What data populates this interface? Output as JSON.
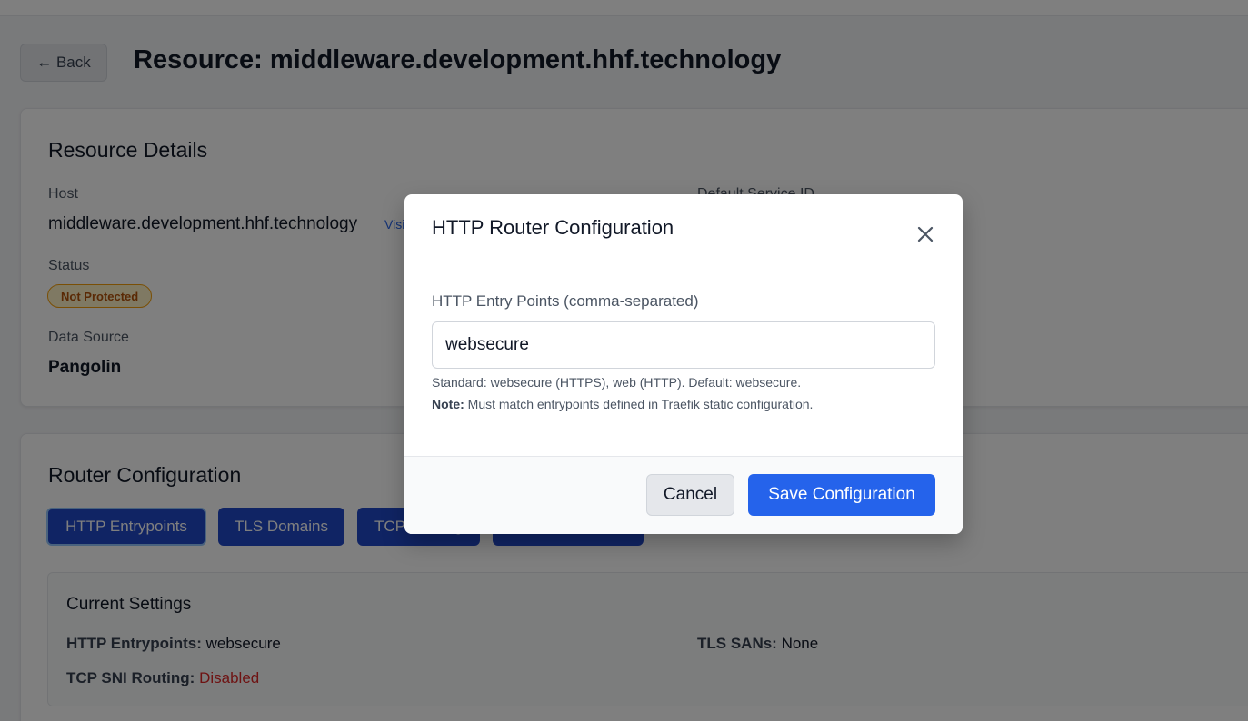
{
  "header": {
    "back_label": "← Back",
    "title": "Resource: middleware.development.hhf.technology"
  },
  "details": {
    "title": "Resource Details",
    "host_label": "Host",
    "host_value": "middleware.development.hhf.technology",
    "visit_label": "Visit",
    "service_label": "Default Service ID",
    "status_label": "Status",
    "status_value": "Not Protected",
    "source_label": "Data Source",
    "source_value": "Pangolin"
  },
  "router": {
    "title": "Router Configuration",
    "tabs": [
      {
        "label": "HTTP Entrypoints"
      },
      {
        "label": "TLS Domains"
      },
      {
        "label": "TCP Routing"
      },
      {
        "label": ""
      }
    ],
    "current_settings_title": "Current Settings",
    "settings": {
      "http_entrypoints_label": "HTTP Entrypoints:",
      "http_entrypoints_value": "websecure",
      "tls_sans_label": "TLS SANs:",
      "tls_sans_value": "None",
      "tcp_sni_label": "TCP SNI Routing:",
      "tcp_sni_value": "Disabled"
    }
  },
  "modal": {
    "title": "HTTP Router Configuration",
    "input_label": "HTTP Entry Points (comma-separated)",
    "input_value": "websecure",
    "help_standard": "Standard: websecure (HTTPS), web (HTTP). Default: websecure.",
    "help_note_label": "Note:",
    "help_note_text": "Must match entrypoints defined in Traefik static configuration.",
    "cancel_label": "Cancel",
    "save_label": "Save Configuration"
  },
  "colors": {
    "primary": "#2563eb",
    "tab_blue": "#2148c8",
    "status_warning": "#b45309",
    "disabled_red": "#dc2626"
  },
  "icons": {
    "close": "close-icon"
  }
}
